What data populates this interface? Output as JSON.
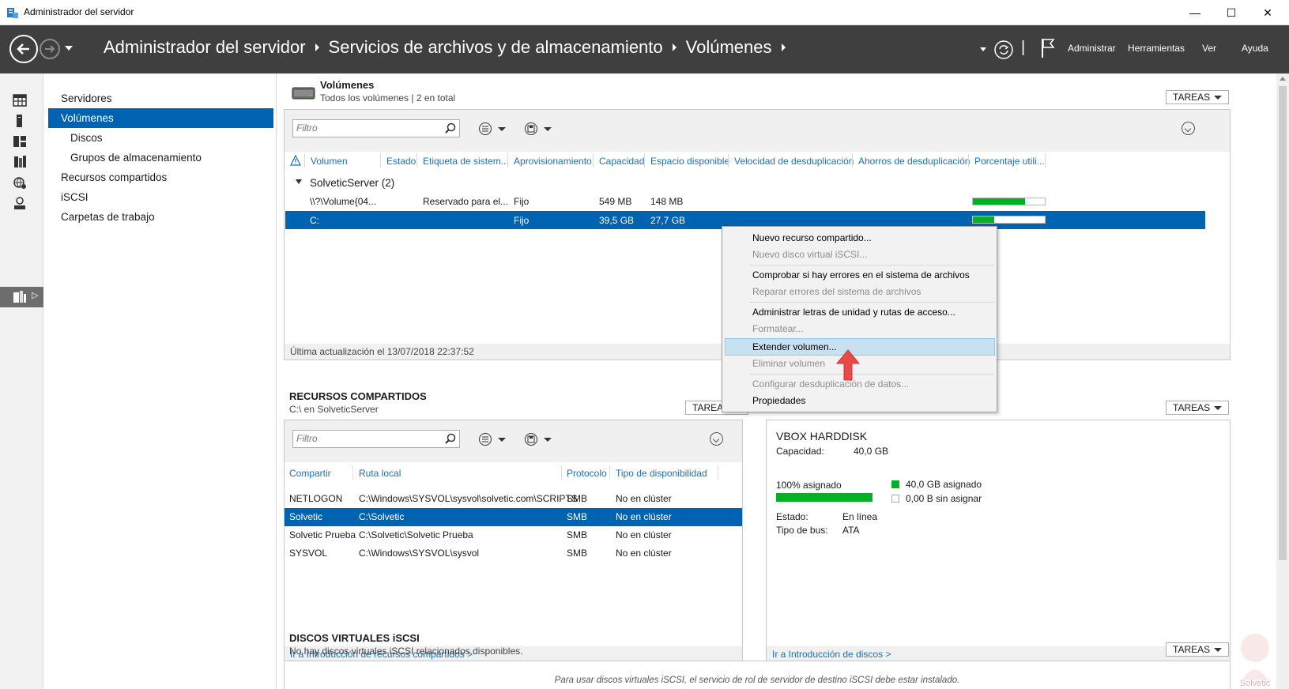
{
  "window": {
    "title": "Administrador del servidor",
    "minimize": "—",
    "maximize": "☐",
    "close": "✕"
  },
  "header": {
    "breadcrumb": [
      "Administrador del servidor",
      "Servicios de archivos y de almacenamiento",
      "Volúmenes"
    ],
    "menu": [
      "Administrar",
      "Herramientas",
      "Ver",
      "Ayuda"
    ],
    "separator": "|"
  },
  "iconbar": {
    "icons": [
      "dashboard-icon",
      "local-server-icon",
      "all-servers-icon",
      "file-services-icon",
      "iis-icon",
      "remote-access-icon",
      "storage-icon"
    ],
    "expand": "▷"
  },
  "nav": {
    "items": [
      {
        "label": "Servidores",
        "sub": false,
        "active": false
      },
      {
        "label": "Volúmenes",
        "sub": false,
        "active": true
      },
      {
        "label": "Discos",
        "sub": true,
        "active": false
      },
      {
        "label": "Grupos de almacenamiento",
        "sub": true,
        "active": false
      },
      {
        "label": "Recursos compartidos",
        "sub": false,
        "active": false
      },
      {
        "label": "iSCSI",
        "sub": false,
        "active": false
      },
      {
        "label": "Carpetas de trabajo",
        "sub": false,
        "active": false
      }
    ]
  },
  "volumes": {
    "title": "Volúmenes",
    "subtitle": "Todos los volúmenes | 2 en total",
    "tasks": "TAREAS",
    "filter_placeholder": "Filtro",
    "columns": [
      "Volumen",
      "Estado",
      "Etiqueta de sistem...",
      "Aprovisionamiento",
      "Capacidad",
      "Espacio disponible",
      "Velocidad de desduplicación",
      "Ahorros de desduplicación",
      "Porcentaje utili..."
    ],
    "group": "SolveticServer (2)",
    "rows": [
      {
        "volume": "\\\\?\\Volume{04...",
        "label": "Reservado para el...",
        "prov": "Fijo",
        "capacity": "549 MB",
        "free": "148 MB",
        "used_pct": 73
      },
      {
        "volume": "C:",
        "label": "",
        "prov": "Fijo",
        "capacity": "39,5 GB",
        "free": "27,7 GB",
        "used_pct": 30
      }
    ],
    "status": "Última actualización el 13/07/2018 22:37:52"
  },
  "context_menu": {
    "items": [
      {
        "label": "Nuevo recurso compartido...",
        "enabled": true
      },
      {
        "label": "Nuevo disco virtual iSCSI...",
        "enabled": false
      },
      {
        "label": "Comprobar si hay errores en el sistema de archivos",
        "enabled": true
      },
      {
        "label": "Reparar errores del sistema de archivos",
        "enabled": false
      },
      {
        "label": "Administrar letras de unidad y rutas de acceso...",
        "enabled": true
      },
      {
        "label": "Formatear...",
        "enabled": false
      },
      {
        "label": "Extender volumen...",
        "enabled": true,
        "highlighted": true
      },
      {
        "label": "Eliminar volumen",
        "enabled": false
      },
      {
        "label": "Configurar desduplicación de datos...",
        "enabled": false
      },
      {
        "label": "Propiedades",
        "enabled": true
      }
    ]
  },
  "shares": {
    "title": "RECURSOS COMPARTIDOS",
    "subtitle": "C:\\ en SolveticServer",
    "tasks": "TAREAS",
    "filter_placeholder": "Filtro",
    "columns": [
      "Compartir",
      "Ruta local",
      "Protocolo",
      "Tipo de disponibilidad"
    ],
    "rows": [
      {
        "share": "NETLOGON",
        "path": "C:\\Windows\\SYSVOL\\sysvol\\solvetic.com\\SCRIPTS",
        "protocol": "SMB",
        "avail": "No en clúster"
      },
      {
        "share": "Solvetic",
        "path": "C:\\Solvetic",
        "protocol": "SMB",
        "avail": "No en clúster"
      },
      {
        "share": "Solvetic Prueba",
        "path": "C:\\Solvetic\\Solvetic Prueba",
        "protocol": "SMB",
        "avail": "No en clúster"
      },
      {
        "share": "SYSVOL",
        "path": "C:\\Windows\\SYSVOL\\sysvol",
        "protocol": "SMB",
        "avail": "No en clúster"
      }
    ],
    "link": "Ir a Introducción de recursos compartidos >"
  },
  "disk": {
    "tasks": "TAREAS",
    "name": "VBOX HARDDISK",
    "capacity_label": "Capacidad:",
    "capacity_value": "40,0 GB",
    "allocated_pct_label": "100% asignado",
    "allocated_fraction": 1.0,
    "legend_allocated": "40,0 GB asignado",
    "legend_unallocated": "0,00 B sin asignar",
    "state_label": "Estado:",
    "state_value": "En línea",
    "bus_label": "Tipo de bus:",
    "bus_value": "ATA",
    "link": "Ir a Introducción de discos >"
  },
  "iscsi": {
    "title": "DISCOS VIRTUALES iSCSI",
    "subtitle": "No hay discos virtuales iSCSI relacionados disponibles.",
    "tasks": "TAREAS",
    "message": "Para usar discos virtuales iSCSI, el servicio de rol de servidor de destino iSCSI debe estar instalado."
  },
  "watermark": "Solvetic",
  "colors": {
    "header_bg": "#3f3f3f",
    "selection": "#0063b1",
    "progress": "#06b025",
    "link": "#1f6fb5",
    "arrow": "#e84a4a"
  }
}
